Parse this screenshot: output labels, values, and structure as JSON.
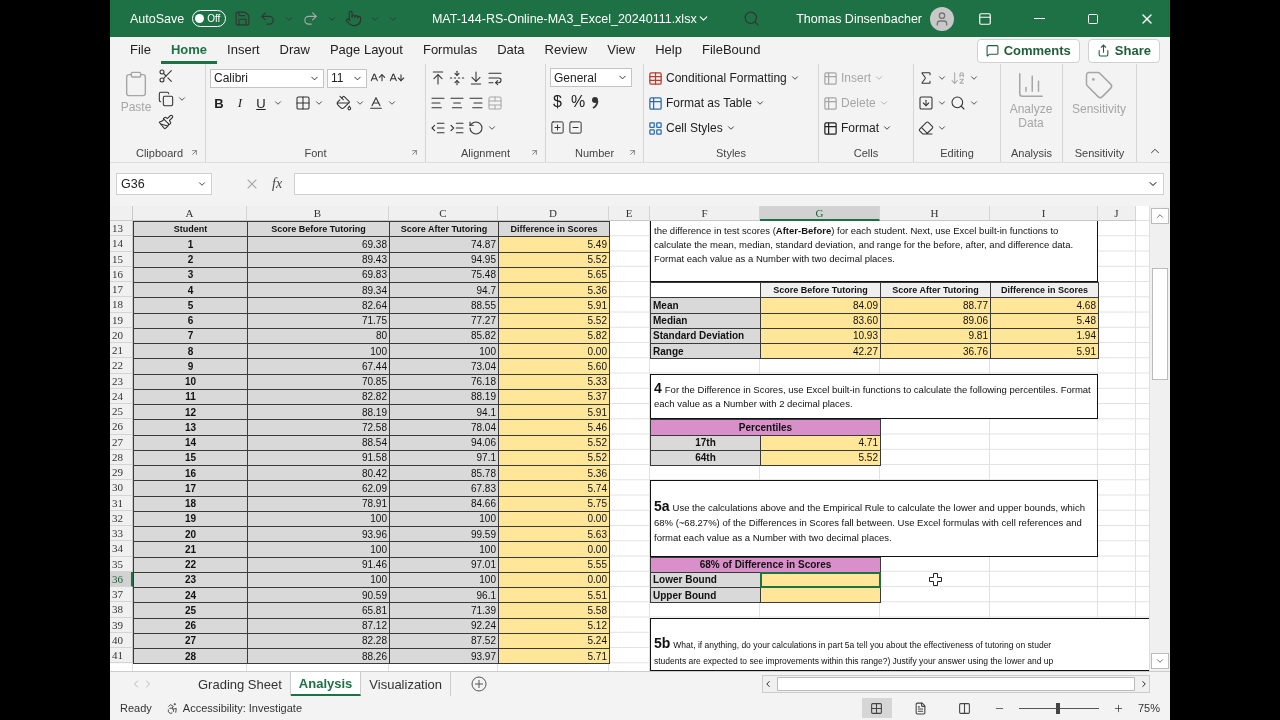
{
  "title_bar": {
    "autosave_label": "AutoSave",
    "autosave_toggle": {
      "label": "Off",
      "on": false
    },
    "file_name": "MAT-144-RS-Online-MA3_Excel_20240111.xlsx",
    "user_name": "Thomas Dinsenbacher"
  },
  "ribbon_tabs": [
    {
      "label": "File",
      "selected": false
    },
    {
      "label": "Home",
      "selected": true
    },
    {
      "label": "Insert",
      "selected": false
    },
    {
      "label": "Draw",
      "selected": false
    },
    {
      "label": "Page Layout",
      "selected": false
    },
    {
      "label": "Formulas",
      "selected": false
    },
    {
      "label": "Data",
      "selected": false
    },
    {
      "label": "Review",
      "selected": false
    },
    {
      "label": "View",
      "selected": false
    },
    {
      "label": "Help",
      "selected": false
    },
    {
      "label": "FileBound",
      "selected": false
    }
  ],
  "comments_button": "Comments",
  "share_button": "Share",
  "ribbon": {
    "clipboard": {
      "label": "Clipboard",
      "paste": {
        "label": "Paste",
        "disabled": true
      }
    },
    "font": {
      "label": "Font",
      "font_name": "Calibri",
      "font_size": "11",
      "style_buttons": [
        "B",
        "I",
        "U"
      ]
    },
    "alignment": {
      "label": "Alignment"
    },
    "number": {
      "label": "Number",
      "format": "General",
      "symbol_buttons": [
        "$",
        "%"
      ]
    },
    "styles": {
      "label": "Styles",
      "items": [
        "Conditional Formatting",
        "Format as Table",
        "Cell Styles"
      ]
    },
    "cells": {
      "label": "Cells",
      "items": [
        {
          "label": "Insert",
          "disabled": true
        },
        {
          "label": "Delete",
          "disabled": true
        },
        {
          "label": "Format",
          "disabled": false
        }
      ]
    },
    "editing": {
      "label": "Editing"
    },
    "analysis": {
      "label": "Analysis",
      "button": {
        "label": "Analyze Data",
        "disabled": true
      }
    },
    "sensitivity": {
      "label": "Sensitivity",
      "button": {
        "label": "Sensitivity",
        "disabled": true
      }
    }
  },
  "formula_bar": {
    "name_box": "G36",
    "function_label": "fx"
  },
  "sheet": {
    "columns": [
      {
        "label": "A",
        "selected": false
      },
      {
        "label": "B",
        "selected": false
      },
      {
        "label": "C",
        "selected": false
      },
      {
        "label": "D",
        "selected": false
      },
      {
        "label": "E",
        "selected": false
      },
      {
        "label": "F",
        "selected": false
      },
      {
        "label": "G",
        "selected": true
      },
      {
        "label": "H",
        "selected": false
      },
      {
        "label": "I",
        "selected": false
      },
      {
        "label": "J",
        "selected": false
      }
    ],
    "rows": [
      {
        "label": "13",
        "selected": false
      },
      {
        "label": "14",
        "selected": false
      },
      {
        "label": "15",
        "selected": false
      },
      {
        "label": "16",
        "selected": false
      },
      {
        "label": "17",
        "selected": false
      },
      {
        "label": "18",
        "selected": false
      },
      {
        "label": "19",
        "selected": false
      },
      {
        "label": "20",
        "selected": false
      },
      {
        "label": "21",
        "selected": false
      },
      {
        "label": "22",
        "selected": false
      },
      {
        "label": "23",
        "selected": false
      },
      {
        "label": "24",
        "selected": false
      },
      {
        "label": "25",
        "selected": false
      },
      {
        "label": "26",
        "selected": false
      },
      {
        "label": "27",
        "selected": false
      },
      {
        "label": "28",
        "selected": false
      },
      {
        "label": "29",
        "selected": false
      },
      {
        "label": "30",
        "selected": false
      },
      {
        "label": "31",
        "selected": false
      },
      {
        "label": "32",
        "selected": false
      },
      {
        "label": "33",
        "selected": false
      },
      {
        "label": "34",
        "selected": false
      },
      {
        "label": "35",
        "selected": false
      },
      {
        "label": "36",
        "selected": true
      },
      {
        "label": "37",
        "selected": false
      },
      {
        "label": "38",
        "selected": false
      },
      {
        "label": "39",
        "selected": false
      },
      {
        "label": "40",
        "selected": false
      },
      {
        "label": "41",
        "selected": false
      }
    ],
    "student_table": {
      "headers": [
        "Student",
        "Score Before Tutoring",
        "Score After Tutoring",
        "Difference in Scores"
      ],
      "rows": [
        [
          "1",
          "69.38",
          "74.87",
          "5.49"
        ],
        [
          "2",
          "89.43",
          "94.95",
          "5.52"
        ],
        [
          "3",
          "69.83",
          "75.48",
          "5.65"
        ],
        [
          "4",
          "89.34",
          "94.7",
          "5.36"
        ],
        [
          "5",
          "82.64",
          "88.55",
          "5.91"
        ],
        [
          "6",
          "71.75",
          "77.27",
          "5.52"
        ],
        [
          "7",
          "80",
          "85.82",
          "5.82"
        ],
        [
          "8",
          "100",
          "100",
          "0.00"
        ],
        [
          "9",
          "67.44",
          "73.04",
          "5.60"
        ],
        [
          "10",
          "70.85",
          "76.18",
          "5.33"
        ],
        [
          "11",
          "82.82",
          "88.19",
          "5.37"
        ],
        [
          "12",
          "88.19",
          "94.1",
          "5.91"
        ],
        [
          "13",
          "72.58",
          "78.04",
          "5.46"
        ],
        [
          "14",
          "88.54",
          "94.06",
          "5.52"
        ],
        [
          "15",
          "91.58",
          "97.1",
          "5.52"
        ],
        [
          "16",
          "80.42",
          "85.78",
          "5.36"
        ],
        [
          "17",
          "62.09",
          "67.83",
          "5.74"
        ],
        [
          "18",
          "78.91",
          "84.66",
          "5.75"
        ],
        [
          "19",
          "100",
          "100",
          "0.00"
        ],
        [
          "20",
          "93.96",
          "99.59",
          "5.63"
        ],
        [
          "21",
          "100",
          "100",
          "0.00"
        ],
        [
          "22",
          "91.46",
          "97.01",
          "5.55"
        ],
        [
          "23",
          "100",
          "100",
          "0.00"
        ],
        [
          "24",
          "90.59",
          "96.1",
          "5.51"
        ],
        [
          "25",
          "65.81",
          "71.39",
          "5.58"
        ],
        [
          "26",
          "87.12",
          "92.24",
          "5.12"
        ],
        [
          "27",
          "82.28",
          "87.52",
          "5.24"
        ],
        [
          "28",
          "88.26",
          "93.97",
          "5.71"
        ]
      ]
    },
    "intro_text": "the difference in test scores (**After-Before**) for each student. Next, use Excel built-in functions to calculate the mean, median, standard deviation, and range for the before, after, and difference data. Format each value as a Number with two decimal places.",
    "stats_table": {
      "headers": [
        "Score Before Tutoring",
        "Score After Tutoring",
        "Difference in Scores"
      ],
      "rows": [
        {
          "label": "Mean",
          "values": [
            "84.09",
            "88.77",
            "4.68"
          ]
        },
        {
          "label": "Median",
          "values": [
            "83.60",
            "89.06",
            "5.48"
          ]
        },
        {
          "label": "Standard Deviation",
          "values": [
            "10.93",
            "9.81",
            "1.94"
          ]
        },
        {
          "label": "Range",
          "values": [
            "42.27",
            "36.76",
            "5.91"
          ]
        }
      ]
    },
    "question_4": {
      "number": "4",
      "text": "For the Difference in Scores, use Excel built-in functions to calculate the following percentiles. Format each value as a Number with 2 decimal places."
    },
    "percentiles": {
      "title": "Percentiles",
      "rows": [
        {
          "label": "17th",
          "value": "4.71"
        },
        {
          "label": "64th",
          "value": "5.52"
        }
      ]
    },
    "question_5a": {
      "number": "5a",
      "text": "Use the calculations above and the Empirical Rule to calculate the lower and upper bounds, which 68% (~68.27%) of the Differences in Scores fall between. Use Excel formulas with cell references and format each value as a Number with two decimal places."
    },
    "bounds": {
      "title": "68% of Difference in Scores",
      "rows": [
        {
          "label": "Lower Bound",
          "selected": true
        },
        {
          "label": "Upper Bound",
          "selected": false
        }
      ]
    },
    "question_5b": {
      "number": "5b",
      "lines": [
        "What, if anything, do your calculations in part 5a tell you about the effectiveness of tutoring on studer",
        "students are expected to see improvements within this range?) Justify your answer using the lower and up"
      ]
    }
  },
  "sheet_tabs": [
    {
      "label": "Grading Sheet",
      "selected": false
    },
    {
      "label": "Analysis",
      "selected": true
    },
    {
      "label": "Visualization",
      "selected": false
    }
  ],
  "status_bar": {
    "status": "Ready",
    "accessibility": "Accessibility: Investigate",
    "zoom": {
      "level": 0.49,
      "reading": "75%"
    }
  }
}
